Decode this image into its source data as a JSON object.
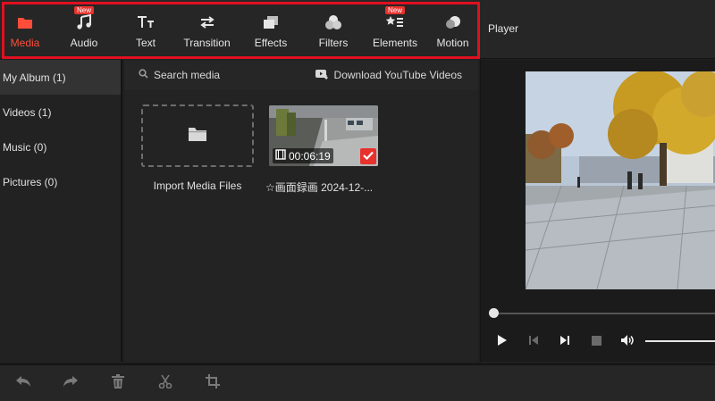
{
  "toolbar": {
    "tabs": [
      {
        "label": "Media",
        "icon": "folder-icon",
        "active": true,
        "badge": ""
      },
      {
        "label": "Audio",
        "icon": "music-note-icon",
        "active": false,
        "badge": "New"
      },
      {
        "label": "Text",
        "icon": "text-icon",
        "active": false,
        "badge": ""
      },
      {
        "label": "Transition",
        "icon": "transition-arrows-icon",
        "active": false,
        "badge": ""
      },
      {
        "label": "Effects",
        "icon": "effects-icon",
        "active": false,
        "badge": ""
      },
      {
        "label": "Filters",
        "icon": "filters-icon",
        "active": false,
        "badge": ""
      },
      {
        "label": "Elements",
        "icon": "elements-icon",
        "active": false,
        "badge": "New"
      },
      {
        "label": "Motion",
        "icon": "motion-icon",
        "active": false,
        "badge": ""
      }
    ],
    "player_title": "Player"
  },
  "albums": [
    {
      "label": "My Album (1)",
      "selected": true
    },
    {
      "label": "Videos (1)",
      "selected": false
    },
    {
      "label": "Music (0)",
      "selected": false
    },
    {
      "label": "Pictures (0)",
      "selected": false
    }
  ],
  "media": {
    "search_label": "Search media",
    "youtube_label": "Download YouTube Videos",
    "import_label": "Import Media Files",
    "clip": {
      "duration": "00:06:19",
      "name": "☆画面録画 2024-12-..."
    }
  },
  "player": {
    "seek_fraction": 0,
    "volume_fraction": 1
  },
  "colors": {
    "accent": "#ff4d3a",
    "highlight_border": "#e01020",
    "badge": "#e8322e",
    "background": "#1f1f1f"
  }
}
